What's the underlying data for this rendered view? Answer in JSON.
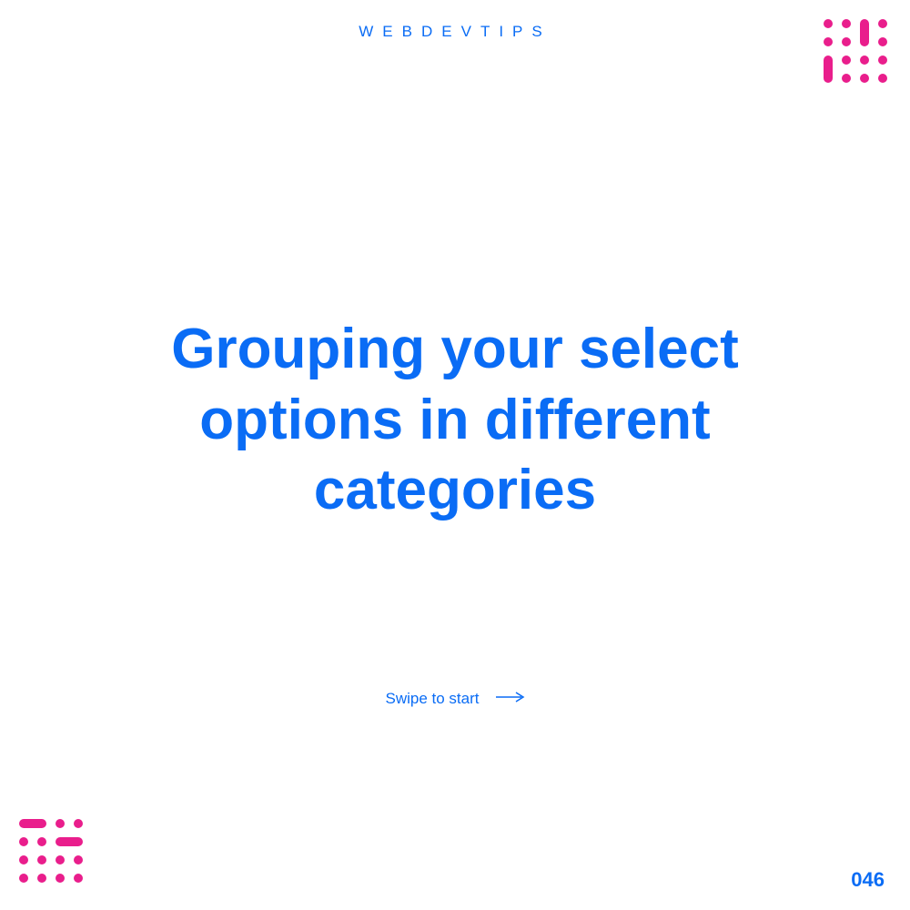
{
  "header": {
    "brand": "WEBDEVTIPS"
  },
  "main": {
    "title": "Grouping your select options in different categories",
    "swipe_label": "Swipe to start"
  },
  "footer": {
    "page_number": "046"
  },
  "colors": {
    "primary": "#0a6cf5",
    "accent": "#e91e8c"
  }
}
